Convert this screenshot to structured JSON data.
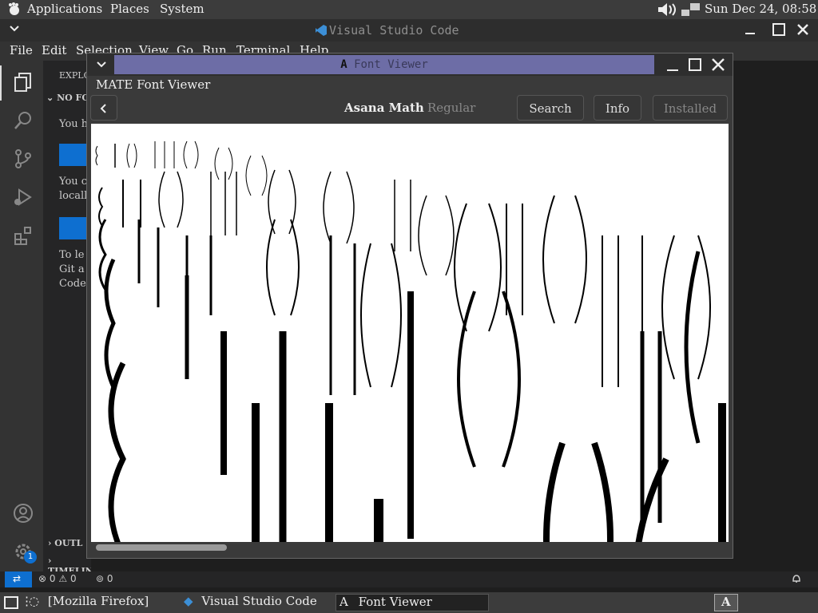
{
  "top_panel": {
    "applications": "Applications",
    "places": "Places",
    "system": "System",
    "clock": "Sun Dec 24, 08:58"
  },
  "vscode": {
    "title": "Visual Studio Code",
    "menu": [
      "File",
      "Edit",
      "Selection",
      "View",
      "Go",
      "Run",
      "Terminal",
      "Help"
    ],
    "sidebar": {
      "explorer": "EXPLO",
      "no_folder": "NO FO",
      "line1": "You h",
      "line2a": "You c",
      "line2b": "locall",
      "line3a": "To le",
      "line3b": "Git a",
      "line3c": "Code",
      "outline": "OUTL",
      "timeline": "TIMELINE"
    },
    "status": {
      "errors": "0",
      "warnings": "0",
      "ports": "0"
    },
    "settings_badge": "1"
  },
  "font_viewer": {
    "window_title": "Font Viewer",
    "app_title": "MATE Font Viewer",
    "font_name": "Asana Math",
    "font_style": "Regular",
    "search_label": "Search",
    "info_label": "Info",
    "installed_label": "Installed"
  },
  "taskbar": {
    "firefox": "[Mozilla Firefox]",
    "vscode": "Visual Studio Code",
    "fontviewer": "Font Viewer"
  }
}
